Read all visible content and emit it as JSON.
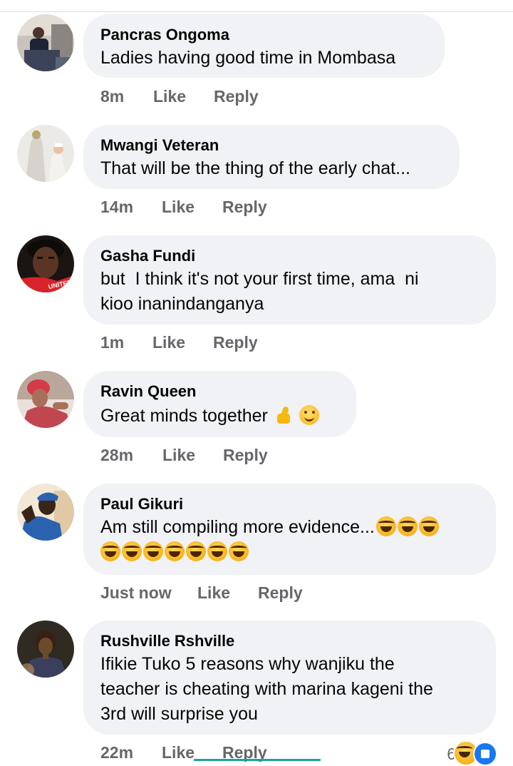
{
  "comments": [
    {
      "author": "Pancras Ongoma",
      "lines": [
        "Ladies having good time in Mombasa"
      ],
      "time": "8m",
      "like": "Like",
      "reply": "Reply",
      "avatar_icon": "person-at-podium-avatar",
      "avatar_colors": [
        "#3b4358",
        "#c9c3bc"
      ]
    },
    {
      "author": "Mwangi Veteran",
      "lines": [
        "That will be the thing of the early chat..."
      ],
      "time": "14m",
      "like": "Like",
      "reply": "Reply",
      "avatar_icon": "statue-and-pope-avatar",
      "avatar_colors": [
        "#eceae6",
        "#b6a77d"
      ]
    },
    {
      "author": "Gasha Fundi",
      "lines": [
        "but  I think it's not your first time, ama  ni",
        "kioo inanindanganya"
      ],
      "time": "1m",
      "like": "Like",
      "reply": "Reply",
      "avatar_icon": "footballer-avatar",
      "avatar_colors": [
        "#2a1a12",
        "#d8232a"
      ],
      "avatar_text": "UNITED"
    },
    {
      "author": "Ravin Queen",
      "lines": [
        "Great minds together"
      ],
      "time": "28m",
      "like": "Like",
      "reply": "Reply",
      "emoji": [
        "thumbs-up",
        "smiling-face"
      ],
      "avatar_icon": "woman-red-hair-avatar",
      "avatar_colors": [
        "#e9e0dc",
        "#c0474f"
      ]
    },
    {
      "author": "Paul Gikuri",
      "lines": [
        "Am still compiling more evidence...",
        ""
      ],
      "time": "Just now",
      "like": "Like",
      "reply": "Reply",
      "emoji_line1": 3,
      "emoji_line2": 7,
      "emoji_name": "rolling-on-floor-laughing",
      "avatar_icon": "man-with-cap-avatar",
      "avatar_colors": [
        "#f2e8d6",
        "#2a62b0"
      ]
    },
    {
      "author": "Rushville Rshville",
      "lines": [
        "Ifikie Tuko 5 reasons why wanjiku the",
        "teacher is cheating with marina kageni the",
        "3rd will surprise you"
      ],
      "time": "22m",
      "like": "Like",
      "reply": "Reply",
      "avatar_icon": "woman-dark-portrait-avatar",
      "avatar_colors": [
        "#2f2a22",
        "#6a4b2a"
      ]
    }
  ],
  "reactions": {
    "count": "6",
    "icons": [
      "laughing-reaction-icon",
      "like-reaction-icon"
    ],
    "like_color": "#1877f2"
  },
  "colors": {
    "bubble": "#f0f2f5",
    "secondary_text": "#65676b",
    "primary_text": "#050505"
  }
}
